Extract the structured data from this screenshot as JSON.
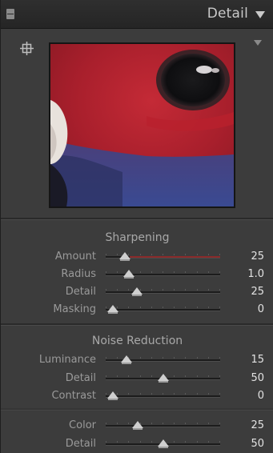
{
  "panel": {
    "title": "Detail"
  },
  "sharpening": {
    "title": "Sharpening",
    "rows": [
      {
        "label": "Amount",
        "value": "25",
        "fraction": 0.17
      },
      {
        "label": "Radius",
        "value": "1.0",
        "fraction": 0.2
      },
      {
        "label": "Detail",
        "value": "25",
        "fraction": 0.27
      },
      {
        "label": "Masking",
        "value": "0",
        "fraction": 0.06
      }
    ]
  },
  "noise_reduction": {
    "title": "Noise Reduction",
    "rows": [
      {
        "label": "Luminance",
        "value": "15",
        "fraction": 0.18
      },
      {
        "label": "Detail",
        "value": "50",
        "fraction": 0.5
      },
      {
        "label": "Contrast",
        "value": "0",
        "fraction": 0.06
      }
    ]
  },
  "color_noise": {
    "rows": [
      {
        "label": "Color",
        "value": "25",
        "fraction": 0.28
      },
      {
        "label": "Detail",
        "value": "50",
        "fraction": 0.5
      }
    ]
  },
  "colors": {
    "header_bg": "#2a2a2a",
    "panel_bg": "#3c3c3c",
    "value_text": "#e2e2e2",
    "amount_track_accent": "#8a2a2a"
  },
  "icons": {
    "target": "target-crosshair-icon",
    "header_collapse": "triangle-down-icon",
    "preview_menu": "triangle-down-icon",
    "solo": "panel-switch-icon"
  }
}
